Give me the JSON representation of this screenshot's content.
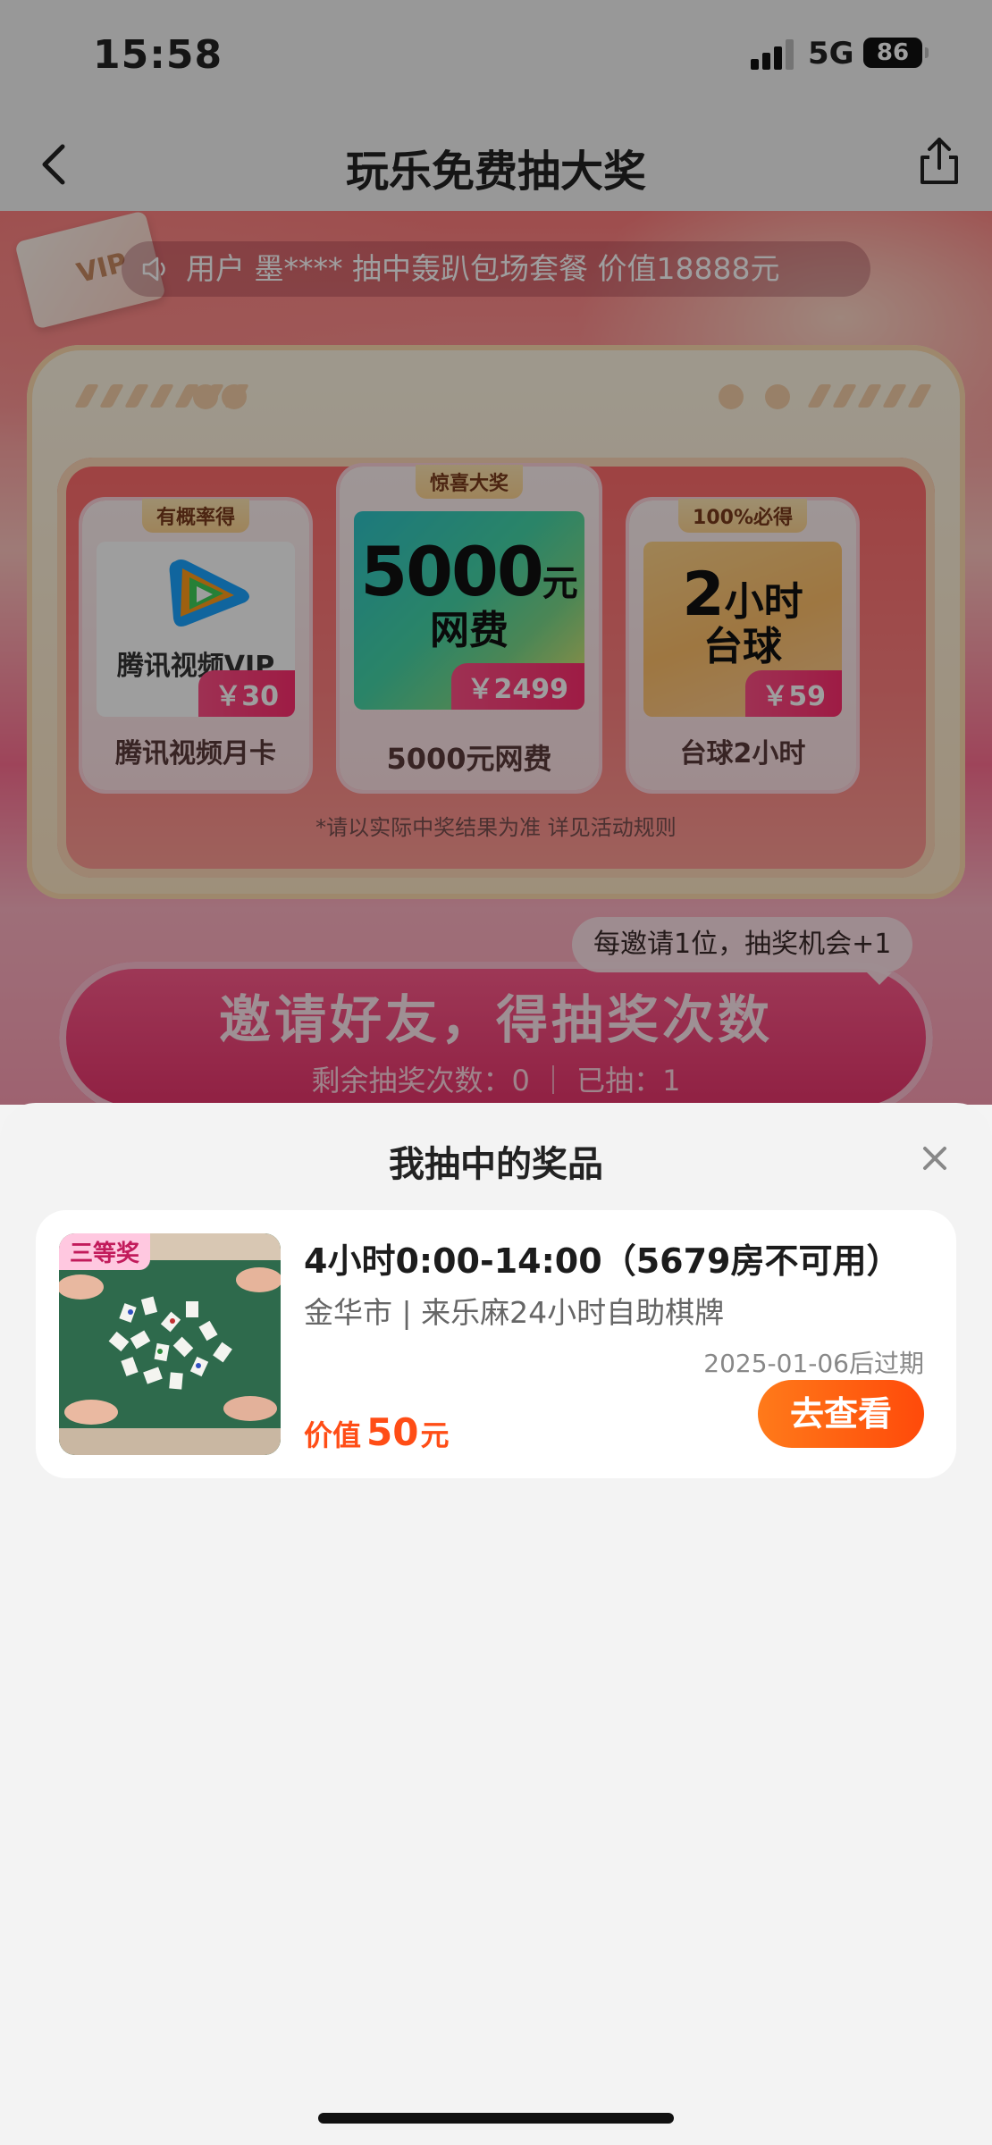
{
  "status_bar": {
    "time": "15:58",
    "network": "5G",
    "battery": "86"
  },
  "nav": {
    "title": "玩乐免费抽大奖"
  },
  "ticker": {
    "text": "用户 墨**** 抽中轰趴包场套餐 价值18888元"
  },
  "prizes": [
    {
      "badge": "有概率得",
      "name": "腾讯视频月卡",
      "price": "￥30",
      "image_text": "腾讯视频VIP"
    },
    {
      "badge": "惊喜大奖",
      "name": "5000元网费",
      "price": "￥2499",
      "image_number": "5000",
      "image_unit": "元",
      "image_sub": "网费"
    },
    {
      "badge": "100%必得",
      "name": "台球2小时",
      "price": "￥59",
      "image_number": "2",
      "image_unit": "小时",
      "image_sub": "台球"
    }
  ],
  "disclaimer": "*请以实际中奖结果为准 详见活动规则",
  "invite": {
    "tip": "每邀请1位，抽奖机会+1",
    "button": "邀请好友，得抽奖次数",
    "remaining": "剩余抽奖次数：0 ｜ 已抽：1"
  },
  "sheet": {
    "title": "我抽中的奖品",
    "item": {
      "tier": "三等奖",
      "title": "4小时0:00-14:00（5679房不可用）",
      "store": "金华市 | 来乐麻24小时自助棋牌",
      "expire": "2025-01-06后过期",
      "value_label": "价值",
      "value_number": "50",
      "value_unit": "元",
      "button": "去查看"
    }
  },
  "colors": {
    "accent": "#ff4d16",
    "button_gradient": [
      "#ff7a1a",
      "#ff4a0a"
    ],
    "invite_pink": "#e8336b"
  }
}
